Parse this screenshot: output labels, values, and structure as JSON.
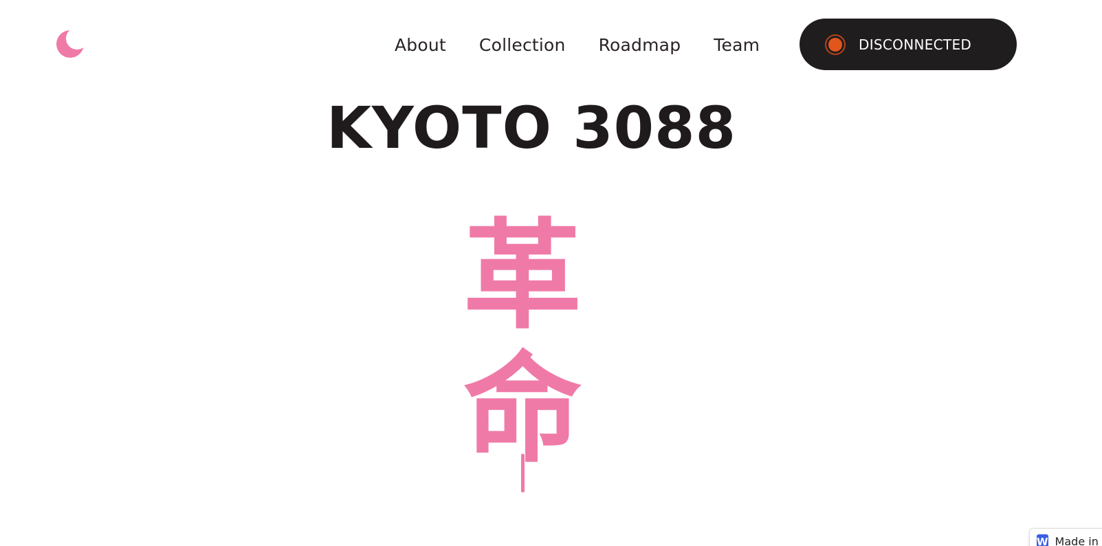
{
  "header": {
    "logo_icon": "crescent-moon-icon",
    "nav": [
      {
        "label": "About"
      },
      {
        "label": "Collection"
      },
      {
        "label": "Roadmap"
      },
      {
        "label": "Team"
      }
    ],
    "connect_button": {
      "label": "DISCONNECTED",
      "status_color": "#e1561d"
    }
  },
  "hero": {
    "title": "KYOTO 3088",
    "calligraphy": {
      "characters": [
        "革",
        "命"
      ],
      "color": "#ef7aa8"
    }
  },
  "badge": {
    "icon_letter": "W",
    "label": "Made in Webflow"
  },
  "colors": {
    "accent_pink": "#ef7aa8",
    "dark": "#201d1e",
    "status_orange": "#e1561d"
  }
}
